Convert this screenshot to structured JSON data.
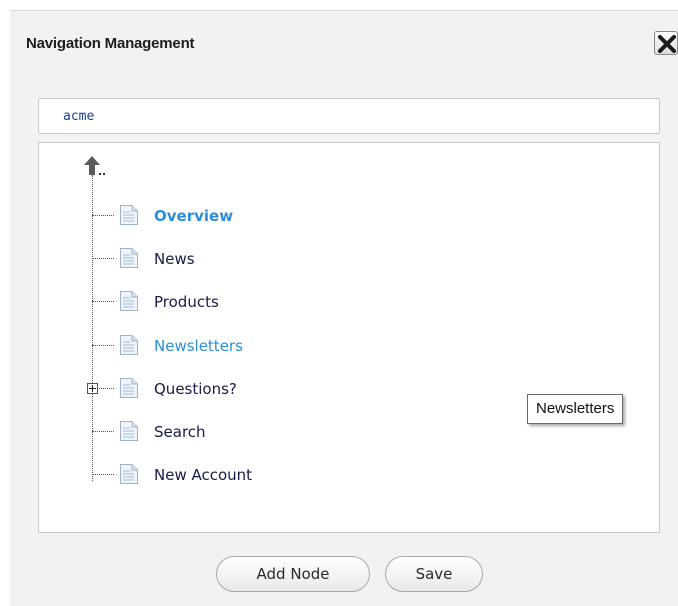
{
  "dialog": {
    "title": "Navigation Management",
    "close_icon": "close-icon"
  },
  "site": {
    "name": "acme"
  },
  "tree": {
    "up_icon": "up-arrow-icon",
    "up_label": "..",
    "node_icon": "document-icon",
    "items": [
      {
        "label": "Overview",
        "state": "selected"
      },
      {
        "label": "News",
        "state": "normal"
      },
      {
        "label": "Products",
        "state": "normal"
      },
      {
        "label": "Newsletters",
        "state": "hovered"
      },
      {
        "label": "Questions?",
        "state": "collapsed"
      },
      {
        "label": "Search",
        "state": "normal"
      },
      {
        "label": "New Account",
        "state": "normal"
      }
    ]
  },
  "tooltip": {
    "text": "Newsletters"
  },
  "buttons": {
    "add_node": "Add Node",
    "save": "Save"
  },
  "colors": {
    "selected_link": "#2a8fd8",
    "node_text": "#1a1a4a",
    "site_text": "#1a3f8c",
    "dialog_bg": "#f2f2f2"
  }
}
